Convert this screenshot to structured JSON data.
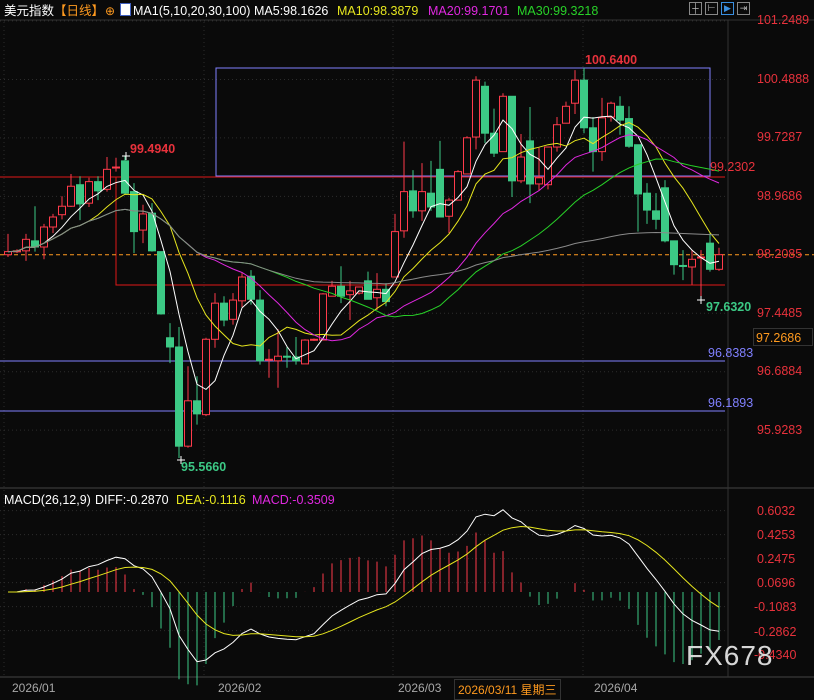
{
  "header": {
    "symbol": "美元指数",
    "period": "【日线】",
    "ma_set": "MA1(5,10,20,30,100)",
    "ma5": "MA5:98.1626",
    "ma10": "MA10:98.3879",
    "ma20": "MA20:99.1701",
    "ma30": "MA30:99.3218",
    "icons": [
      "crosshair-icon",
      "ma-icon",
      "toolbar-icons"
    ]
  },
  "macd_header": {
    "title": "MACD(26,12,9)",
    "diff": "DIFF:-0.2870",
    "dea": "DEA:-0.1116",
    "macd": "MACD:-0.3509"
  },
  "price_axis": [
    "101.2489",
    "100.4888",
    "99.7287",
    "98.9686",
    "98.2085",
    "97.4485",
    "96.6884",
    "95.9283"
  ],
  "macd_axis": [
    "0.6032",
    "0.4253",
    "0.2475",
    "0.0696",
    "-0.1083",
    "-0.2862",
    "-0.4340"
  ],
  "annotations": {
    "high_label": "100.6400",
    "local_high_label": "99.4940",
    "low_label": "95.5660",
    "recent_low_label": "97.6320",
    "resistance_label": "99.2302",
    "support1_label": "96.8383",
    "support2_label": "96.1893",
    "crosshair_price": "97.2686",
    "crosshair_date": "2026/03/11 星期三"
  },
  "dates": [
    "2026/01",
    "2026/02",
    "2026/03",
    "2026/04"
  ],
  "watermark": "FX678",
  "colors": {
    "up": "#ff3b4b",
    "down": "#3cc985",
    "ma5": "#ffffff",
    "ma10": "#e6e61e",
    "ma20": "#e028e0",
    "ma30": "#28d228",
    "ma100": "#8a8a8a",
    "last_price": "#ff9a1f",
    "annotation_blue": "#8080ff",
    "annotation_red": "#e01818"
  },
  "chart_data": {
    "type": "candlestick",
    "ylim": [
      95.4,
      101.3
    ],
    "last_price": 98.2085,
    "ma_periods": [
      5,
      10,
      20,
      30,
      100
    ],
    "candles_ohlc": [
      [
        98.21,
        98.48,
        98.18,
        98.25
      ],
      [
        98.25,
        98.28,
        98.23,
        98.26
      ],
      [
        98.26,
        98.48,
        98.13,
        98.41
      ],
      [
        98.39,
        98.84,
        98.25,
        98.31
      ],
      [
        98.31,
        98.61,
        98.15,
        98.57
      ],
      [
        98.57,
        98.74,
        98.49,
        98.7
      ],
      [
        98.73,
        98.97,
        98.67,
        98.84
      ],
      [
        98.84,
        99.26,
        98.83,
        99.1
      ],
      [
        99.12,
        99.23,
        98.66,
        98.87
      ],
      [
        98.88,
        99.21,
        98.83,
        99.16
      ],
      [
        99.16,
        99.23,
        98.92,
        99.04
      ],
      [
        99.06,
        99.48,
        99.03,
        99.32
      ],
      [
        99.34,
        99.47,
        99.29,
        99.35
      ],
      [
        99.43,
        99.494,
        99.0,
        99.01
      ],
      [
        99.03,
        99.14,
        98.23,
        98.51
      ],
      [
        98.53,
        98.86,
        98.36,
        98.74
      ],
      [
        98.75,
        98.88,
        98.25,
        98.26
      ],
      [
        98.25,
        98.25,
        97.43,
        97.44
      ],
      [
        97.13,
        97.32,
        96.8,
        97.01
      ],
      [
        97.01,
        97.27,
        95.566,
        95.72
      ],
      [
        95.72,
        96.76,
        95.7,
        96.31
      ],
      [
        96.31,
        96.63,
        96.0,
        96.14
      ],
      [
        96.13,
        97.13,
        96.11,
        97.11
      ],
      [
        97.11,
        97.71,
        97.0,
        97.58
      ],
      [
        97.58,
        97.67,
        97.28,
        97.36
      ],
      [
        97.37,
        97.71,
        97.3,
        97.62
      ],
      [
        97.61,
        97.97,
        97.53,
        97.92
      ],
      [
        97.93,
        98.01,
        97.56,
        97.63
      ],
      [
        97.62,
        97.75,
        96.78,
        96.83
      ],
      [
        96.84,
        96.98,
        96.61,
        96.85
      ],
      [
        96.83,
        97.24,
        96.48,
        96.89
      ],
      [
        96.89,
        97.01,
        96.74,
        96.88
      ],
      [
        96.88,
        97.14,
        96.78,
        96.83
      ],
      [
        96.79,
        97.11,
        96.79,
        97.1
      ],
      [
        97.1,
        97.12,
        97.09,
        97.11
      ],
      [
        97.1,
        97.71,
        97.1,
        97.7
      ],
      [
        97.67,
        97.87,
        97.67,
        97.8
      ],
      [
        97.8,
        98.06,
        97.58,
        97.67
      ],
      [
        97.69,
        97.87,
        97.36,
        97.74
      ],
      [
        97.71,
        97.79,
        97.69,
        97.79
      ],
      [
        97.87,
        97.99,
        97.63,
        97.63
      ],
      [
        97.65,
        97.97,
        97.49,
        97.76
      ],
      [
        97.76,
        97.84,
        97.54,
        97.6
      ],
      [
        97.92,
        98.74,
        97.92,
        98.51
      ],
      [
        98.52,
        99.68,
        98.43,
        99.03
      ],
      [
        99.04,
        99.31,
        98.69,
        98.78
      ],
      [
        98.78,
        99.4,
        98.65,
        99.03
      ],
      [
        99.01,
        99.43,
        98.78,
        98.83
      ],
      [
        99.32,
        99.69,
        98.7,
        98.7
      ],
      [
        98.71,
        98.95,
        98.49,
        98.92
      ],
      [
        98.92,
        99.31,
        98.92,
        99.29
      ],
      [
        99.26,
        99.75,
        99.26,
        99.73
      ],
      [
        99.74,
        100.53,
        99.58,
        100.48
      ],
      [
        100.4,
        100.46,
        99.66,
        99.79
      ],
      [
        99.79,
        100.11,
        99.48,
        99.53
      ],
      [
        99.55,
        100.31,
        99.55,
        100.27
      ],
      [
        100.27,
        100.27,
        98.96,
        99.17
      ],
      [
        99.17,
        99.78,
        99.14,
        99.48
      ],
      [
        99.69,
        100.13,
        98.88,
        99.13
      ],
      [
        99.13,
        99.6,
        99.05,
        99.21
      ],
      [
        99.12,
        99.61,
        99.06,
        99.61
      ],
      [
        99.61,
        100.0,
        99.55,
        99.9
      ],
      [
        99.92,
        100.2,
        99.92,
        100.14
      ],
      [
        100.18,
        100.61,
        100.04,
        100.48
      ],
      [
        100.48,
        100.64,
        99.79,
        99.86
      ],
      [
        99.86,
        100.0,
        99.29,
        99.55
      ],
      [
        99.55,
        100.25,
        99.43,
        99.99
      ],
      [
        100.0,
        100.2,
        99.94,
        100.18
      ],
      [
        100.14,
        100.27,
        99.77,
        99.96
      ],
      [
        99.98,
        100.14,
        99.6,
        99.62
      ],
      [
        99.64,
        99.64,
        98.51,
        99.0
      ],
      [
        99.01,
        99.14,
        98.61,
        98.79
      ],
      [
        98.78,
        99.01,
        98.54,
        98.67
      ],
      [
        99.08,
        99.18,
        98.37,
        98.39
      ],
      [
        98.39,
        98.39,
        97.95,
        98.08
      ],
      [
        98.07,
        98.27,
        97.88,
        98.06
      ],
      [
        98.05,
        98.27,
        97.82,
        98.15
      ],
      [
        98.17,
        98.27,
        97.632,
        98.18
      ],
      [
        98.36,
        98.49,
        97.99,
        98.02
      ],
      [
        98.02,
        98.3,
        98.0,
        98.21
      ]
    ],
    "levels": [
      99.2302,
      96.8383,
      96.1893
    ],
    "macd": {
      "fast": 12,
      "slow": 26,
      "signal": 9,
      "ylim": [
        -0.434,
        0.6032
      ]
    }
  }
}
